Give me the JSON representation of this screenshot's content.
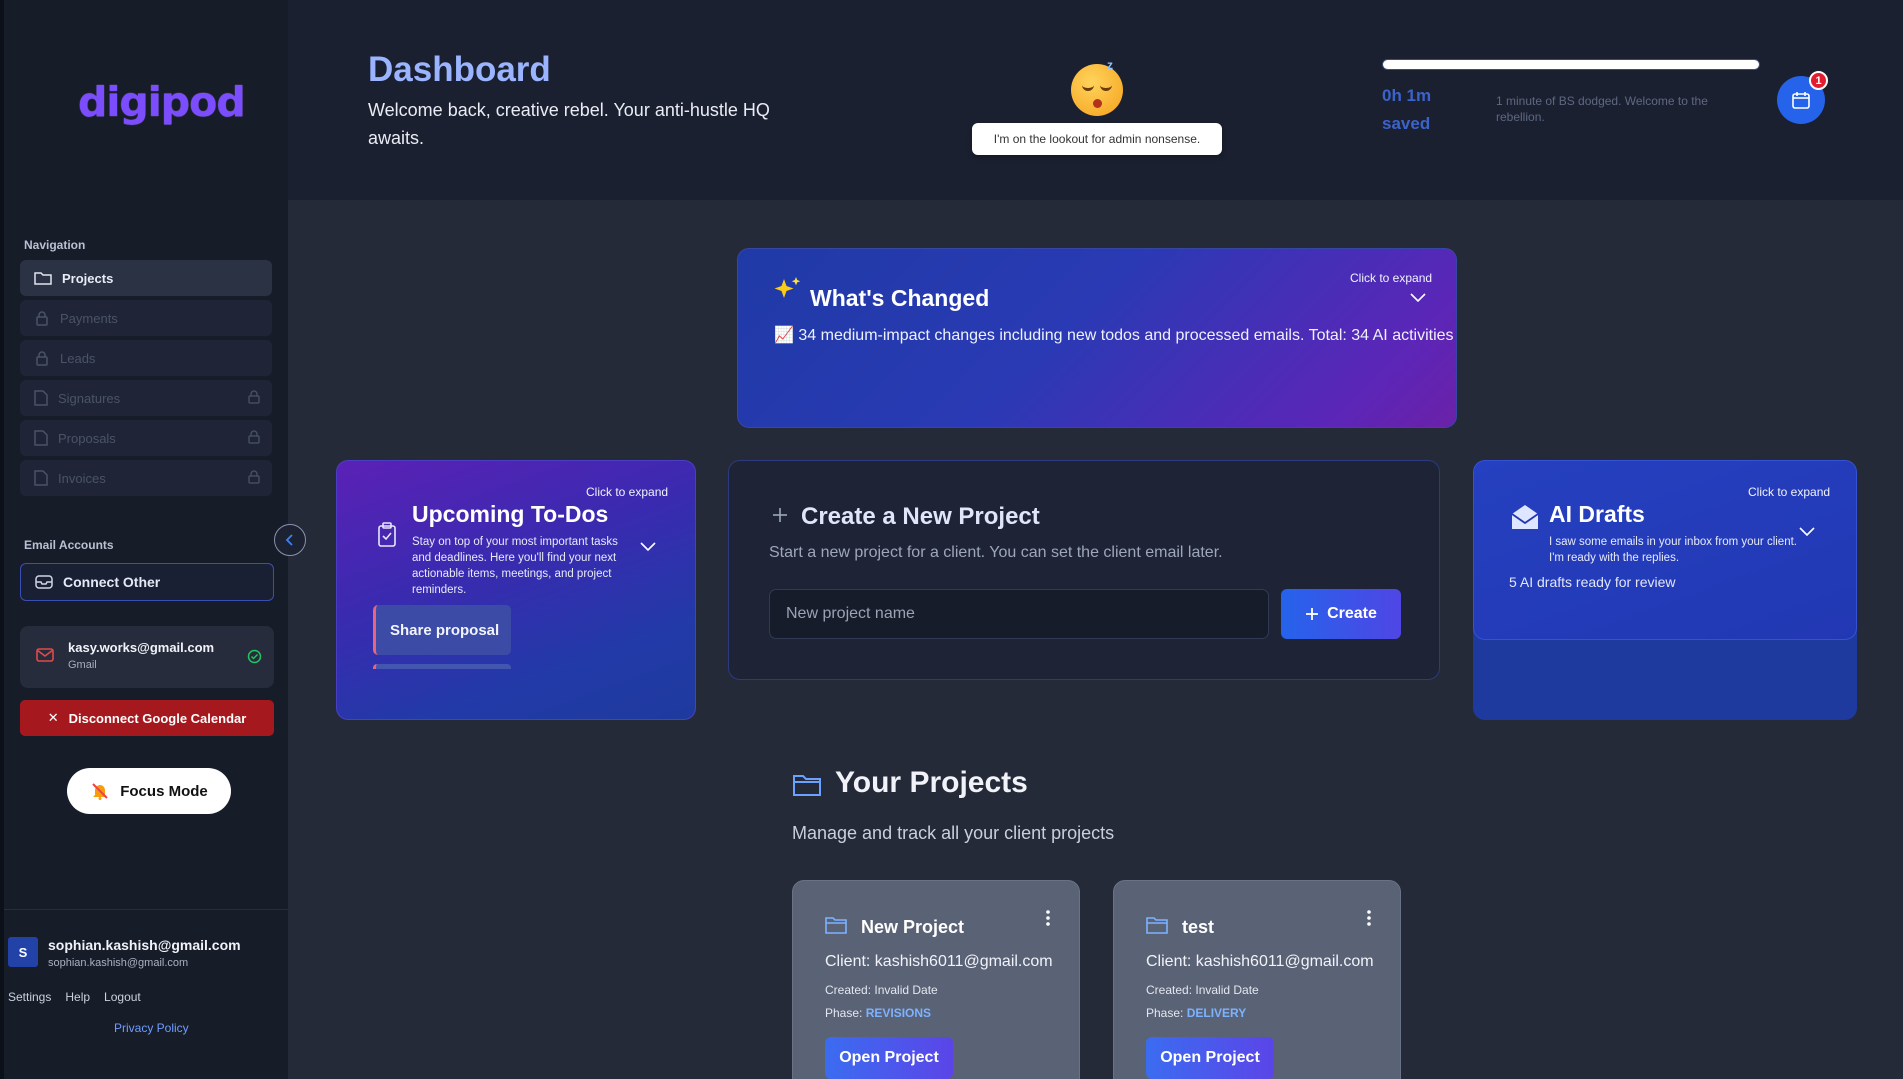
{
  "brand": {
    "logo": "digipod",
    "logo_color": "#7b4dff"
  },
  "sidebar": {
    "nav_label": "Navigation",
    "items": [
      {
        "label": "Projects",
        "icon": "folder-icon",
        "active": true,
        "locked": false
      },
      {
        "label": "Payments",
        "icon": "lock-icon",
        "active": false,
        "locked": true
      },
      {
        "label": "Leads",
        "icon": "lock-icon",
        "active": false,
        "locked": true
      },
      {
        "label": "Signatures",
        "icon": "document-icon",
        "active": false,
        "locked": true
      },
      {
        "label": "Proposals",
        "icon": "document-icon",
        "active": false,
        "locked": true
      },
      {
        "label": "Invoices",
        "icon": "document-icon",
        "active": false,
        "locked": true
      }
    ],
    "email_label": "Email Accounts",
    "connect_other": "Connect Other",
    "account": {
      "email": "kasy.works@gmail.com",
      "provider": "Gmail"
    },
    "disconnect_calendar": "Disconnect Google Calendar",
    "focus_mode": "Focus Mode",
    "user": {
      "initial": "S",
      "name": "sophian.kashish@gmail.com",
      "email": "sophian.kashish@gmail.com"
    },
    "footer": {
      "settings": "Settings",
      "help": "Help",
      "logout": "Logout",
      "privacy": "Privacy Policy"
    }
  },
  "header": {
    "title": "Dashboard",
    "subtitle": "Welcome back, creative rebel. Your anti-hustle HQ awaits.",
    "mascot_tooltip": "I'm on the lookout for admin nonsense.",
    "progress": 1.0,
    "saved_time": "0h 1m saved",
    "saved_message": "1 minute of BS dodged. Welcome to the rebellion.",
    "notification_count": "1"
  },
  "whats_changed": {
    "title": "What's Changed",
    "expand_hint": "Click to expand",
    "summary": "📈 34 medium-impact changes including new todos and processed emails. Total: 34 AI activities i"
  },
  "todos": {
    "title": "Upcoming To-Dos",
    "expand_hint": "Click to expand",
    "description": "Stay on top of your most important tasks and deadlines. Here you'll find your next actionable items, meetings, and project reminders.",
    "items": [
      "Share proposal"
    ]
  },
  "create_project": {
    "title": "Create a New Project",
    "subtitle": "Start a new project for a client. You can set the client email later.",
    "input_placeholder": "New project name",
    "button": "Create"
  },
  "ai_drafts": {
    "title": "AI Drafts",
    "expand_hint": "Click to expand",
    "description": "I saw some emails in your inbox from your client. I'm ready with the replies.",
    "count_text": "5 AI drafts ready for review"
  },
  "projects": {
    "title": "Your Projects",
    "subtitle": "Manage and track all your client projects",
    "items": [
      {
        "name": "New Project",
        "client": "Client: kashish6011@gmail.com",
        "created": "Created: Invalid Date",
        "phase_label": "Phase:",
        "phase": "REVISIONS",
        "open": "Open Project"
      },
      {
        "name": "test",
        "client": "Client: kashish6011@gmail.com",
        "created": "Created: Invalid Date",
        "phase_label": "Phase:",
        "phase": "DELIVERY",
        "open": "Open Project"
      }
    ]
  }
}
